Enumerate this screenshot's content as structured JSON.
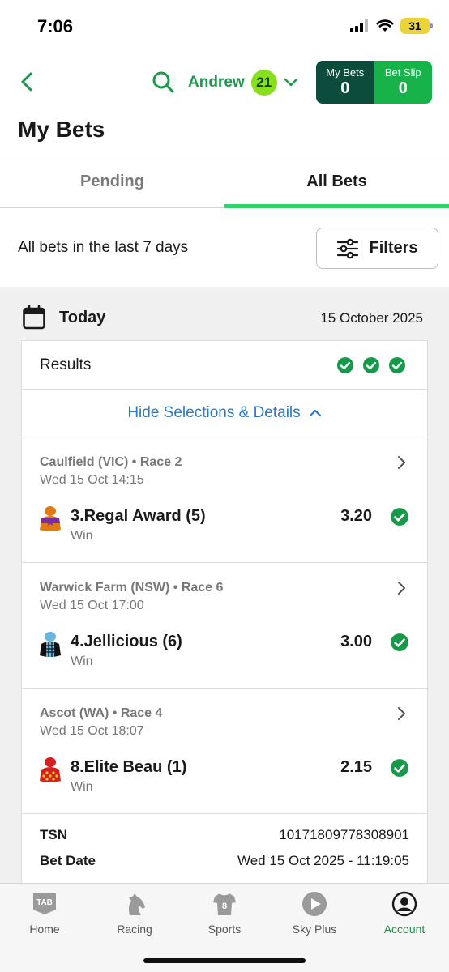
{
  "status_bar": {
    "time": "7:06",
    "battery": "31"
  },
  "header": {
    "user_name": "Andrew",
    "user_badge": "21",
    "my_bets_label": "My Bets",
    "my_bets_count": "0",
    "bet_slip_label": "Bet Slip",
    "bet_slip_count": "0"
  },
  "page_title": "My Bets",
  "tabs": [
    {
      "label": "Pending",
      "active": false
    },
    {
      "label": "All Bets",
      "active": true
    }
  ],
  "filter": {
    "text": "All bets in the last 7 days",
    "button_label": "Filters"
  },
  "day": {
    "label": "Today",
    "date": "15 October 2025"
  },
  "bet": {
    "results_label": "Results",
    "toggle_label": "Hide Selections & Details",
    "selections": [
      {
        "meeting": "Caulfield (VIC) • Race 2",
        "time": "Wed 15 Oct 14:15",
        "runner": "3.Regal Award (5)",
        "bet_type": "Win",
        "odds": "3.20"
      },
      {
        "meeting": "Warwick Farm (NSW) • Race 6",
        "time": "Wed 15 Oct 17:00",
        "runner": "4.Jellicious (6)",
        "bet_type": "Win",
        "odds": "3.00"
      },
      {
        "meeting": "Ascot (WA) • Race 4",
        "time": "Wed 15 Oct 18:07",
        "runner": "8.Elite Beau (1)",
        "bet_type": "Win",
        "odds": "2.15"
      }
    ],
    "details": [
      {
        "key": "TSN",
        "value": "10171809778308901"
      },
      {
        "key": "Bet Date",
        "value": "Wed 15 Oct 2025 - 11:19:05"
      }
    ]
  },
  "bottom_nav": [
    {
      "label": "Home",
      "icon": "tab-logo-icon"
    },
    {
      "label": "Racing",
      "icon": "horse-head-icon"
    },
    {
      "label": "Sports",
      "icon": "jersey-icon"
    },
    {
      "label": "Sky Plus",
      "icon": "play-circle-icon"
    },
    {
      "label": "Account",
      "icon": "account-icon",
      "active": true
    }
  ],
  "colors": {
    "accent_green": "#17b34a",
    "dark_green": "#0c4c3c",
    "link_blue": "#2a78c8",
    "tab_underline": "#2fd46a"
  }
}
